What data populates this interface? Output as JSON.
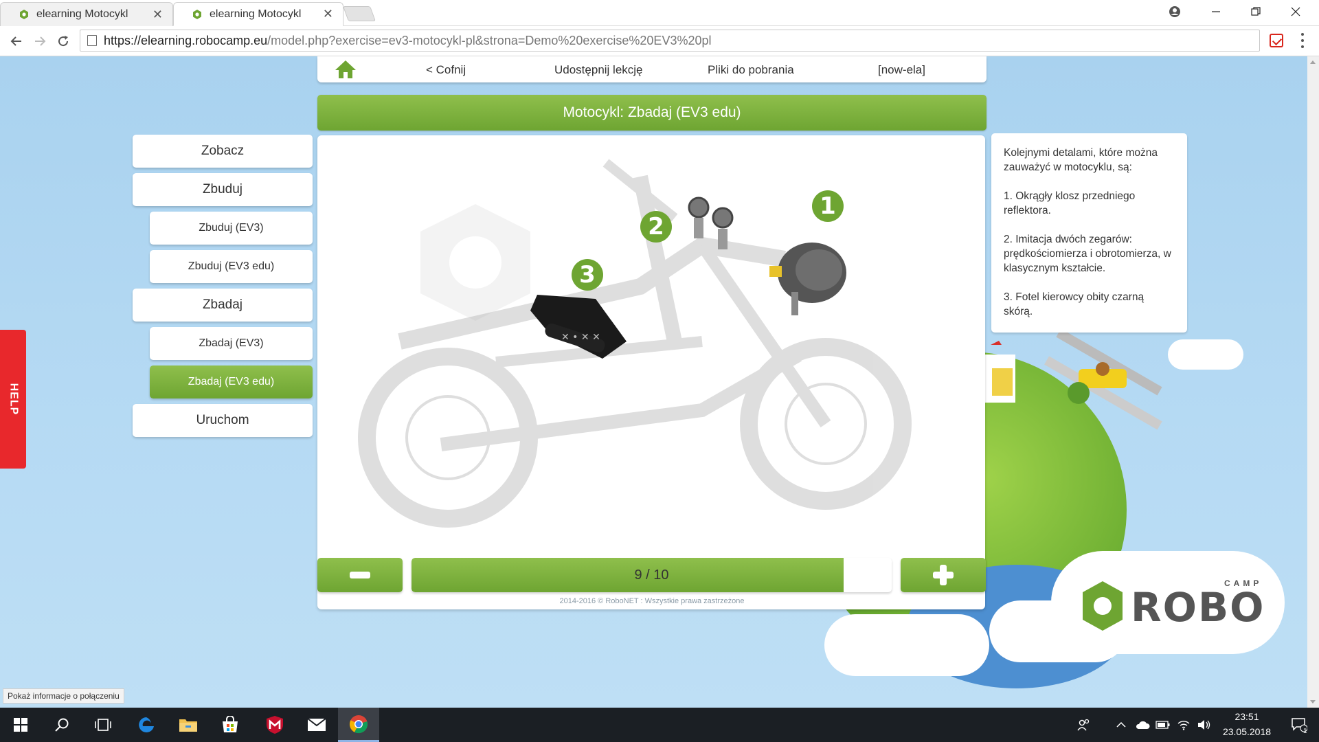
{
  "browser": {
    "tabs": [
      {
        "title": "elearning Motocykl",
        "active": false
      },
      {
        "title": "elearning Motocykl",
        "active": true
      }
    ],
    "url_host": "https://elearning.robocamp.eu",
    "url_path": "/model.php?exercise=ev3-motocykl-pl&strona=Demo%20exercise%20EV3%20pl",
    "icons": {
      "back": "arrow-left-icon",
      "forward": "arrow-right-icon",
      "reload": "reload-icon",
      "account": "account-icon",
      "minimize": "minimize-icon",
      "restore": "restore-icon",
      "close": "close-icon",
      "extension": "pocket-extension-icon",
      "menu": "kebab-menu-icon"
    }
  },
  "topnav": {
    "home_icon": "home-icon",
    "back": "< Cofnij",
    "share": "Udostępnij lekcję",
    "downloads": "Pliki do pobrania",
    "user": "[now-ela]"
  },
  "title": "Motocykl: Zbadaj (EV3 edu)",
  "menu": [
    {
      "label": "Zobacz",
      "level": 1,
      "active": false
    },
    {
      "label": "Zbuduj",
      "level": 1,
      "active": false
    },
    {
      "label": "Zbuduj (EV3)",
      "level": 2,
      "active": false
    },
    {
      "label": "Zbuduj (EV3 edu)",
      "level": 2,
      "active": false
    },
    {
      "label": "Zbadaj",
      "level": 1,
      "active": false
    },
    {
      "label": "Zbadaj (EV3)",
      "level": 2,
      "active": false
    },
    {
      "label": "Zbadaj (EV3 edu)",
      "level": 2,
      "active": true
    },
    {
      "label": "Uruchom",
      "level": 1,
      "active": false
    }
  ],
  "viewer": {
    "badges": [
      "1",
      "2",
      "3"
    ]
  },
  "info": {
    "paragraphs": [
      "Kolejnymi detalami, które można zauważyć w motocyklu, są:",
      "1. Okrągły klosz przedniego reflektora.",
      "2. Imitacja dwóch zegarów: prędkościomierza i obrotomierza, w klasycznym kształcie.",
      "3. Fotel kierowcy obity czarną skórą."
    ]
  },
  "pager": {
    "label": "9 / 10",
    "current": 9,
    "total": 10,
    "minus_icon": "minus-icon",
    "plus_icon": "plus-icon"
  },
  "copyright": "2014-2016 © RoboNET : Wszystkie prawa zastrzeżone",
  "help": "HELP",
  "status_tooltip": "Pokaż informacje o połączeniu",
  "logo": {
    "main": "ROBO",
    "sub": "CAMP"
  },
  "taskbar": {
    "time": "23:51",
    "date": "23.05.2018",
    "notification_count": "1"
  },
  "colors": {
    "accent_green": "#6ea532",
    "help_red": "#e8282c",
    "page_bg": "#b4d9f3"
  }
}
